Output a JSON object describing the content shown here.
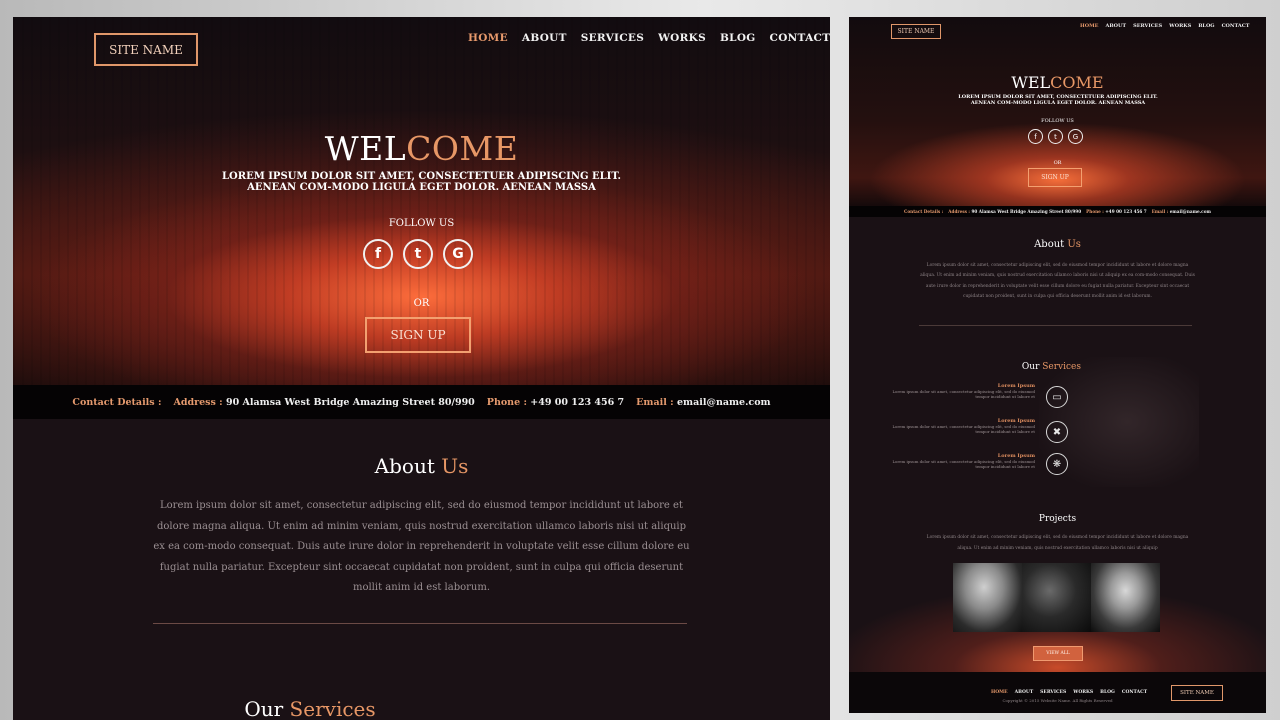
{
  "site_name": "SITE NAME",
  "nav": [
    "HOME",
    "ABOUT",
    "SERVICES",
    "WORKS",
    "BLOG",
    "CONTACT"
  ],
  "hero": {
    "welcome_part1": "WEL",
    "welcome_part2": "COME",
    "subtitle": "LOREM IPSUM DOLOR SIT AMET, CONSECTETUER ADIPISCING ELIT. AENEAN COM-MODO LIGULA EGET DOLOR. AENEAN MASSA",
    "follow_us": "FOLLOW US",
    "social": [
      {
        "icon": "facebook-icon",
        "glyph": "f"
      },
      {
        "icon": "twitter-icon",
        "glyph": "t"
      },
      {
        "icon": "google-icon",
        "glyph": "G"
      }
    ],
    "or": "OR",
    "signup": "SIGN UP"
  },
  "contact": {
    "details_label": "Contact Details :",
    "address_label": "Address :",
    "address_value": "90  Alamsa West Bridge Amazing Street 80/990",
    "phone_label": "Phone :",
    "phone_value": "+49 00 123 456 7",
    "email_label": "Email :",
    "email_value": "email@name.com"
  },
  "about": {
    "title_part1": "About ",
    "title_part2": "Us",
    "text": "Lorem ipsum dolor sit amet, consectetur adipiscing elit, sed do eiusmod tempor incididunt ut labore et dolore magna aliqua. Ut enim ad minim veniam, quis nostrud exercitation ullamco laboris nisi ut aliquip ex ea com-modo consequat. Duis aute irure dolor in reprehenderit in voluptate velit esse cillum dolore eu fugiat nulla pariatur. Excepteur sint occaecat cupidatat non proident, sunt in culpa qui officia deserunt mollit anim id est laborum."
  },
  "services": {
    "title_part1": "Our ",
    "title_part2": "Services",
    "items": [
      {
        "title": "Lorem Ipsum",
        "desc": "Lorem ipsum dolor sit amet, consectetur adipiscing elit, sed do eiusmod tempor incididunt ut labore et",
        "icon": "laptop-icon"
      },
      {
        "title": "Lorem Ipsum",
        "desc": "Lorem ipsum dolor sit amet, consectetur adipiscing elit, sed do eiusmod tempor incididunt ut labore et",
        "icon": "tools-icon"
      },
      {
        "title": "Lorem Ipsum",
        "desc": "Lorem ipsum dolor sit amet, consectetur adipiscing elit, sed do eiusmod tempor incididunt ut labore et",
        "icon": "network-icon"
      }
    ]
  },
  "projects": {
    "title": "Projects",
    "text": "Lorem ipsum dolor sit amet, consectetur adipiscing elit, sed do eiusmod tempor incididunt ut labore et dolore magna aliqua. Ut enim ad minim veniam, quis nostrud exercitation ullamco laboris nisi ut aliquip",
    "view_all": "VIEW ALL"
  },
  "footer": {
    "copyright": "Copyright © 2015 Website Name. All Rights Reserved"
  },
  "colors": {
    "accent": "#e79766",
    "background": "#1a1115",
    "contact_bar": "#050304"
  }
}
